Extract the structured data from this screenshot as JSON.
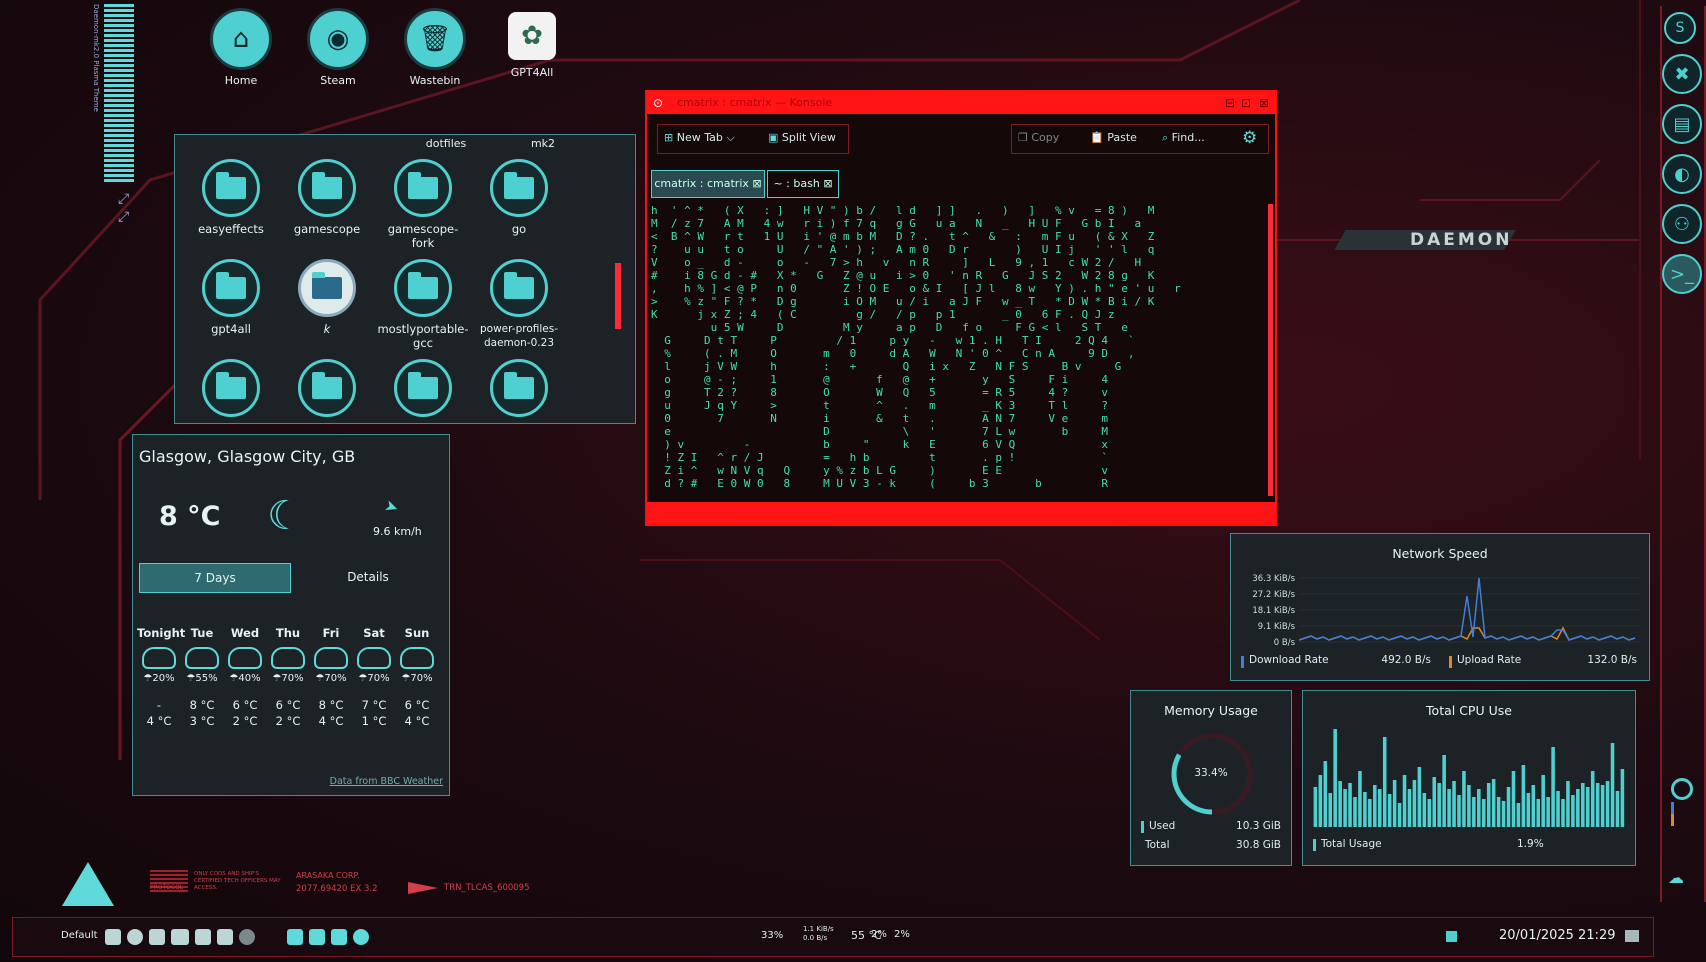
{
  "desktop_icons": [
    {
      "label": "Home",
      "icon": "home-icon"
    },
    {
      "label": "Steam",
      "icon": "steam-icon"
    },
    {
      "label": "Wastebin",
      "icon": "trash-icon"
    },
    {
      "label": "GPT4All",
      "icon": "gpt4all-icon"
    }
  ],
  "folder_view": {
    "top_labels": [
      "dotfiles",
      "mk2"
    ],
    "items": [
      {
        "label": "easyeffects"
      },
      {
        "label": "gamescope"
      },
      {
        "label": "gamescope-fork"
      },
      {
        "label": "go"
      },
      {
        "label": "gpt4all"
      },
      {
        "label": "k"
      },
      {
        "label": "mostlyportable-gcc"
      },
      {
        "label": "power-profiles-daemon-0.23"
      }
    ]
  },
  "konsole": {
    "title": "cmatrix : cmatrix — Konsole",
    "toolbar": {
      "new_tab": "New Tab",
      "split_view": "Split View",
      "copy": "Copy",
      "paste": "Paste",
      "find": "Find..."
    },
    "tabs": [
      "cmatrix : cmatrix",
      "~ : bash"
    ],
    "matrix_lines": [
      "h  ' ^ *   ( X   : ]   H V \" ) b /   l d   ] ]   .   )   ]   % v   = 8 )   M",
      "M  / z 7   A M   4 w   r i ) f 7 q   g G   u a   N   _   H U F   G b I   a",
      "<  B ^ W   r t   1 U   i ' @ m b M   D ? .   t ^   &   :   m F u   ( & X   Z",
      "?    u u   t o     U   / \" A ' ) ;   A m 0   D r       )   U I j   ' ' l   q",
      "V    o _   d -     o   -   7 > h   v   n R     ]   L   9 , 1   c W 2 /   H",
      "#    i 8 G d - #   X *   G   Z @ u   i > 0   ' n R   G   J S 2   W 2 8 g   K",
      ",    h % ] < @ P   n 0       Z ! O E   o & I   [ J l   8 w   Y ) . h \" e ' u   r",
      ">    % z \" F ? *   D g       i O M   u / i   a J F   w _ T   * D W * B i / K",
      "K      j x Z ; 4   ( C         g /   / p   p 1       _ 0   6 F . Q J z",
      "         u 5 W     D         M y     a p   D   f o     F G < l   S T   e",
      "  G     D t T     P         / 1     p y   -   w 1 . H   T I     2 Q 4   `",
      "  %     ( . M     O       m   0     d A   W   N ' 0 ^   C n A     9 D   ,",
      "  l     j V W     h       :   +       Q   i x   Z   N F S     B v     G",
      "  o     @ - ;     1       @       f   @   +       y   S     F i     4",
      "  g     T 2 ?     8       O       W   Q   5       = R 5     4 ?     v",
      "  u     J q Y     >       t       ^   .   m       _ K 3     T l     ?",
      "  0       7       N       i       &   t   .       A N 7     V e     m",
      "  e                       D           \\   '       7 L w       b     M",
      "  ) v         -           b     \"     k   E       6 V Q             x",
      "  ! Z I   ^ r / J         =   h b         t       . p !             `",
      "  Z i ^   w N V q   Q     y % z b L G     )       E E               v",
      "  d ? #   E 0 W 0   8     M U V 3 - k     (     b 3       b         R"
    ]
  },
  "weather": {
    "location": "Glasgow, Glasgow City, GB",
    "temp": "8 °C",
    "wind": "9.6 km/h",
    "tab_7days": "7 Days",
    "tab_details": "Details",
    "days": [
      {
        "name": "Tonight",
        "precip": "20%",
        "high": "-",
        "low": "4 °C"
      },
      {
        "name": "Tue",
        "precip": "55%",
        "high": "8 °C",
        "low": "3 °C"
      },
      {
        "name": "Wed",
        "precip": "40%",
        "high": "6 °C",
        "low": "2 °C"
      },
      {
        "name": "Thu",
        "precip": "70%",
        "high": "6 °C",
        "low": "2 °C"
      },
      {
        "name": "Fri",
        "precip": "70%",
        "high": "8 °C",
        "low": "4 °C"
      },
      {
        "name": "Sat",
        "precip": "70%",
        "high": "7 °C",
        "low": "1 °C"
      },
      {
        "name": "Sun",
        "precip": "70%",
        "high": "6 °C",
        "low": "4 °C"
      }
    ],
    "source": "Data from BBC Weather"
  },
  "network": {
    "title": "Network Speed",
    "ticks": [
      "36.3 KiB/s",
      "27.2 KiB/s",
      "18.1 KiB/s",
      "9.1 KiB/s",
      "0 B/s"
    ],
    "download_label": "Download Rate",
    "download_value": "492.0 B/s",
    "upload_label": "Upload Rate",
    "upload_value": "132.0 B/s",
    "colors": {
      "download": "#3f7fd8",
      "upload": "#d98a2a"
    }
  },
  "memory": {
    "title": "Memory Usage",
    "percent_text": "33.4%",
    "percent": 33.4,
    "used_label": "Used",
    "used_value": "10.3 GiB",
    "total_label": "Total",
    "total_value": "30.8 GiB"
  },
  "cpu": {
    "title": "Total CPU Use",
    "label": "Total Usage",
    "value": "1.9%",
    "bars": [
      40,
      52,
      66,
      34,
      98,
      46,
      38,
      44,
      30,
      56,
      35,
      28,
      42,
      38,
      90,
      33,
      47,
      24,
      52,
      38,
      47,
      60,
      34,
      28,
      50,
      44,
      72,
      38,
      46,
      32,
      56,
      42,
      30,
      38,
      28,
      44,
      48,
      30,
      26,
      40,
      56,
      24,
      62,
      34,
      42,
      28,
      52,
      30,
      80,
      36,
      28,
      46,
      32,
      38,
      44,
      40,
      56,
      44,
      42,
      46,
      84,
      36,
      58
    ]
  },
  "brand": {
    "name": "DAEMON",
    "subtitle": "Daemon-mk2.0 Plasma Theme"
  },
  "warning": {
    "protocol": "PROTOCOL",
    "warn_text": "ONLY CODS AND SHIP'S CERTIFIED TECH OFFICERS MAY ACCESS.",
    "corp": "ARASAKA CORP.",
    "corp_code": "2077.69420 EX 3.2",
    "trn": "TRN_TLCAS_600095"
  },
  "taskbar": {
    "layout": "Default",
    "cpu_load": "33%",
    "net_up": "1.1 KiB/s",
    "net_down": "0.0 B/s",
    "temp": "55 °C",
    "pct1": "2%",
    "pct2": "2%",
    "datetime": "20/01/2025 21:29"
  }
}
